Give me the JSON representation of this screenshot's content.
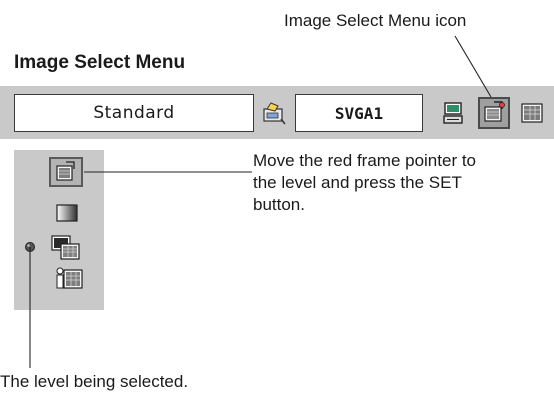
{
  "callouts": {
    "menu_icon_label": "Image Select Menu icon",
    "instruction_lines": [
      "Move the red frame pointer to",
      "the level and press the SET",
      "button."
    ],
    "level_note": "The level being selected."
  },
  "menu": {
    "title": "Image Select Menu"
  },
  "toolbar": {
    "image_mode": "Standard",
    "input_source": "SVGA1",
    "icons": [
      "input-icon",
      "computer-icon",
      "image-select-menu-icon",
      "image-adjust-icon"
    ]
  },
  "side_menu": {
    "levels": [
      "image-select-level-icon",
      "standard-level-icon",
      "real-level-icon",
      "image-memory-level-icon"
    ],
    "current_level_marker": "level-pointer-icon"
  },
  "colors": {
    "panel_gray": "#c9c9c9",
    "line": "#222222"
  }
}
